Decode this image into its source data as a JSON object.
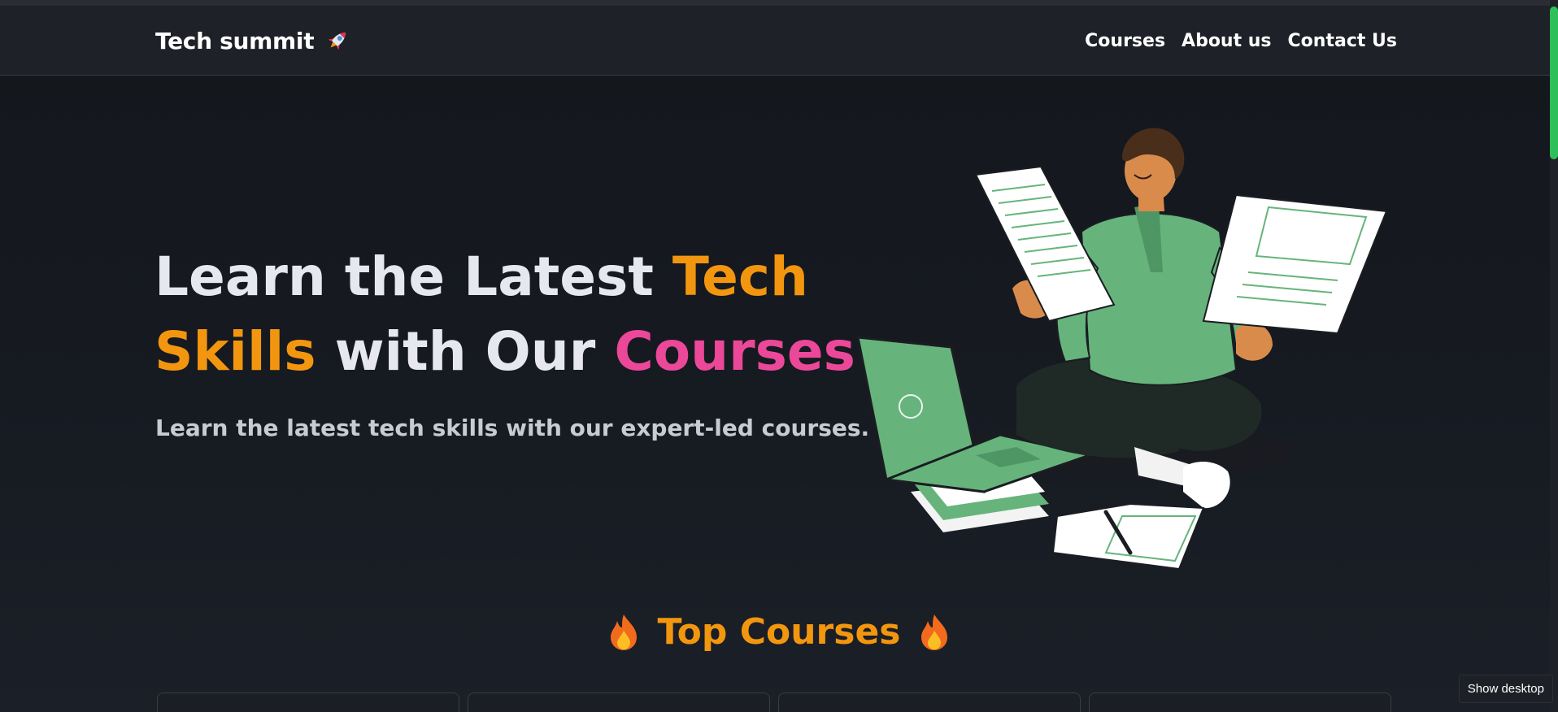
{
  "navbar": {
    "brand": "Tech summit",
    "links": [
      "Courses",
      "About us",
      "Contact Us"
    ]
  },
  "hero": {
    "title_part1": "Learn the Latest ",
    "title_highlight1": "Tech Skills",
    "title_part2": " with Our ",
    "title_highlight2": "Courses",
    "subtitle": "Learn the latest tech skills with our expert-led courses."
  },
  "section": {
    "title": "Top Courses"
  },
  "taskbar": {
    "tooltip": "Show desktop"
  },
  "colors": {
    "accent_orange": "#f3960f",
    "accent_pink": "#ec4899",
    "shirt_green": "#66b47c",
    "scroll_thumb": "#2fbf5a"
  },
  "icons": {
    "brand_icon": "rocket-icon",
    "section_icon": "fire-icon"
  }
}
